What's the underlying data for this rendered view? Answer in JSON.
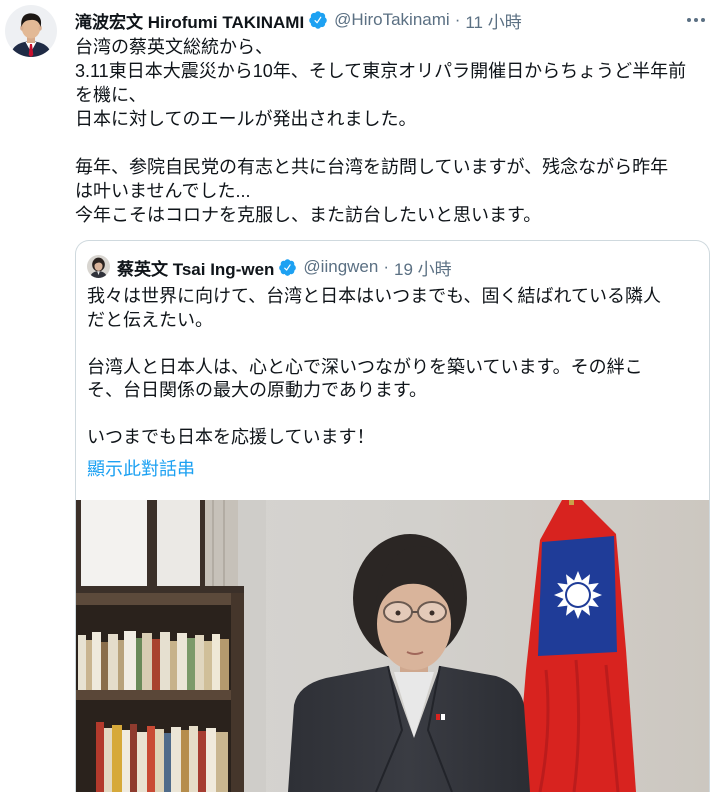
{
  "theme": {
    "accent": "#1da1f2",
    "text": "#0f1419",
    "secondary_text": "#5b7083",
    "border": "#cfd9de"
  },
  "icons": {
    "more": "more-horizontal-icon",
    "verified": "verified-badge-icon"
  },
  "tweet": {
    "author": {
      "display_name": "滝波宏文 Hirofumi TAKINAMI",
      "handle": "@HiroTakinami",
      "separator": "·",
      "time": "11 小時",
      "verified": true
    },
    "text_lines": [
      "台湾の蔡英文総統から、",
      "3.11東日本大震災から10年、そして東京オリパラ開催日からちょうど半年前",
      "を機に、",
      "日本に対してのエールが発出されました。",
      "毎年、参院自民党の有志と共に台湾を訪問していますが、残念ながら昨年",
      "は叶いませんでした...",
      "今年こそはコロナを克服し、また訪台したいと思います。"
    ],
    "quoted": {
      "author": {
        "display_name": "蔡英文 Tsai Ing-wen",
        "handle": "@iingwen",
        "separator": "·",
        "time": "19 小時",
        "verified": true
      },
      "text_lines": [
        "我々は世界に向けて、台湾と日本はいつまでも、固く結ばれている隣人",
        "だと伝えたい。",
        "台湾人と日本人は、心と心で深いつながりを築いています。その絆こ",
        "そ、台日関係の最大の原動力であります。",
        "いつまでも日本を応援しています！"
      ],
      "show_thread_label": "顯示此對話串"
    }
  }
}
